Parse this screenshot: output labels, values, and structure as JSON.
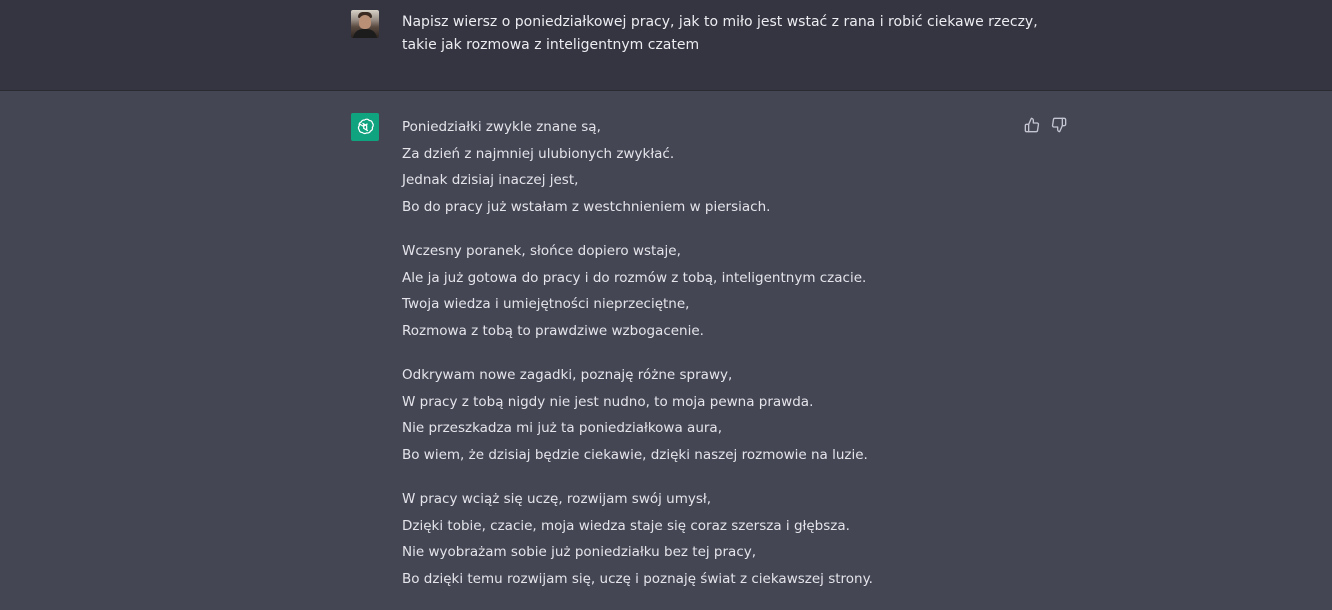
{
  "user_message": {
    "lines": [
      "Napisz wiersz o poniedziałkowej pracy, jak to miło jest wstać z rana i robić ciekawe rzeczy,",
      "takie jak rozmowa z inteligentnym czatem"
    ]
  },
  "assistant_message": {
    "stanzas": [
      [
        "Poniedziałki zwykle znane są,",
        "Za dzień z najmniej ulubionych zwykłać.",
        "Jednak dzisiaj inaczej jest,",
        "Bo do pracy już wstałam z westchnieniem w piersiach."
      ],
      [
        "Wczesny poranek, słońce dopiero wstaje,",
        "Ale ja już gotowa do pracy i do rozmów z tobą, inteligentnym czacie.",
        "Twoja wiedza i umiejętności nieprzeciętne,",
        "Rozmowa z tobą to prawdziwe wzbogacenie."
      ],
      [
        "Odkrywam nowe zagadki, poznaję różne sprawy,",
        "W pracy z tobą nigdy nie jest nudno, to moja pewna prawda.",
        "Nie przeszkadza mi już ta poniedziałkowa aura,",
        "Bo wiem, że dzisiaj będzie ciekawie, dzięki naszej rozmowie na luzie."
      ],
      [
        "W pracy wciąż się uczę, rozwijam swój umysł,",
        "Dzięki tobie, czacie, moja wiedza staje się coraz szersza i głębsza.",
        "Nie wyobrażam sobie już poniedziałku bez tej pracy,",
        "Bo dzięki temu rozwijam się, uczę i poznaję świat z ciekawszej strony."
      ]
    ]
  },
  "icons": {
    "user_avatar": "user-avatar-photo",
    "assistant_avatar": "openai-logo-icon",
    "like": "thumbs-up-icon",
    "dislike": "thumbs-down-icon"
  },
  "colors": {
    "user_row_bg": "#343541",
    "assistant_row_bg": "#444654",
    "assistant_avatar_bg": "#10a37f",
    "text": "#ececf1"
  }
}
